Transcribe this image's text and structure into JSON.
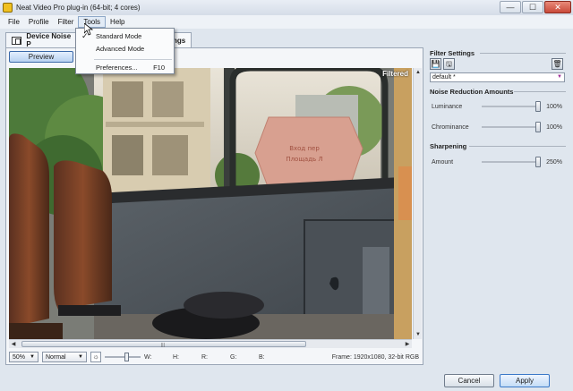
{
  "window": {
    "title": "Neat Video Pro plug-in (64-bit; 4 cores)"
  },
  "window_controls": {
    "minimize": "—",
    "maximize": "☐",
    "close": "✕"
  },
  "menu": [
    "File",
    "Profile",
    "Filter",
    "Tools",
    "Help"
  ],
  "tools_menu": {
    "items": [
      {
        "label": "Standard Mode",
        "checked": true,
        "check_glyph": "✓"
      },
      {
        "label": "Advanced Mode",
        "checked": false
      },
      {
        "label": "Preferences...",
        "shortcut": "F10"
      }
    ]
  },
  "tabs": {
    "device_noise": "Device Noise P",
    "filter_settings": "ngs"
  },
  "preview": {
    "button": "Preview",
    "overlay_label": "Filtered",
    "sign_text_line1": "Вход пер",
    "sign_text_line2": "Площадь Л"
  },
  "scroll": {
    "up": "▲",
    "down": "▼",
    "left": "◀",
    "right": "▶",
    "grip": "|||"
  },
  "statusbar": {
    "zoom": "50%",
    "mode": "Normal",
    "exposure_icon": "☼",
    "w_label": "W:",
    "h_label": "H:",
    "r_label": "R:",
    "g_label": "G:",
    "b_label": "B:",
    "frame_info": "Frame: 1920x1080, 32-bit RGB",
    "combo_arrow": "▼"
  },
  "filter_settings": {
    "title": "Filter Settings",
    "save_icon": "💾",
    "saveas_icon": "🖫",
    "delete_icon": "🗑",
    "preset": "default *",
    "preset_arrow": "▼"
  },
  "noise_reduction": {
    "title": "Noise Reduction Amounts",
    "rows": [
      {
        "label": "Luminance",
        "value": "100%",
        "level": 1.0
      },
      {
        "label": "Chrominance",
        "value": "100%",
        "level": 1.0
      }
    ]
  },
  "sharpening": {
    "title": "Sharpening",
    "rows": [
      {
        "label": "Amount",
        "value": "250%",
        "level": 1.0
      }
    ]
  },
  "buttons": {
    "cancel": "Cancel",
    "apply": "Apply"
  }
}
